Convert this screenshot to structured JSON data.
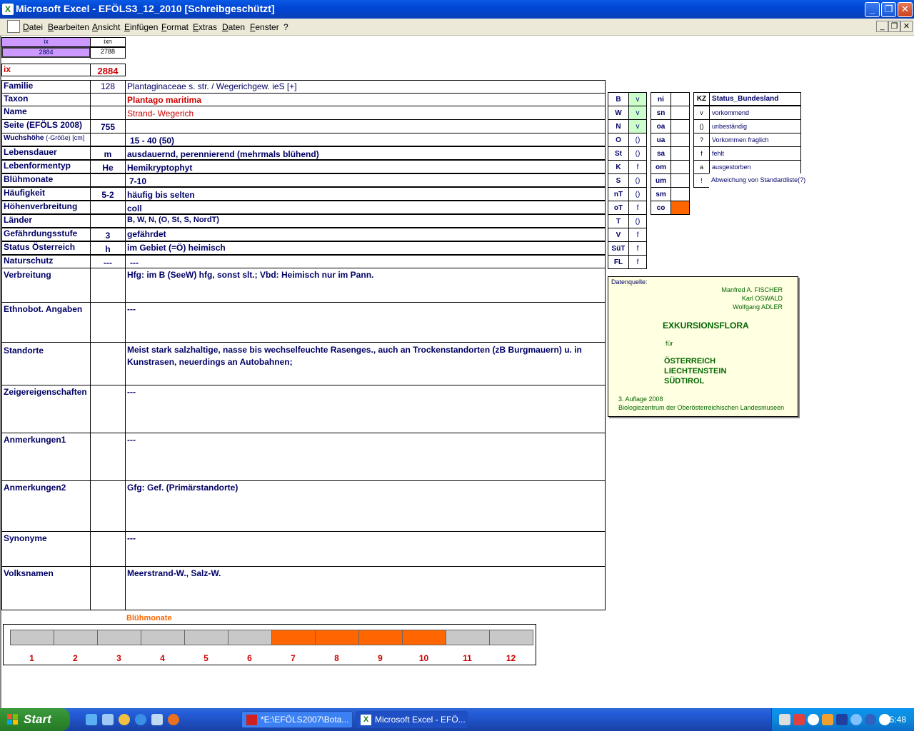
{
  "window": {
    "title": "Microsoft Excel - EFÖLS3_12_2010  [Schreibgeschützt]",
    "app_icon": "X"
  },
  "menu": [
    "Datei",
    "Bearbeiten",
    "Ansicht",
    "Einfügen",
    "Format",
    "Extras",
    "Daten",
    "Fenster",
    "?"
  ],
  "index": {
    "ix_head": "ix",
    "ixn_head": "ixn",
    "ix_val": "2884",
    "ixn_val": "2788",
    "ix_label": "ix",
    "ix_big": "2884"
  },
  "rows": [
    {
      "label": "Familie",
      "code": "128",
      "value": "Plantaginaceae s. str.  /  Wegerichgew. ieS [+]"
    },
    {
      "label": "Taxon",
      "code": "",
      "value": "Plantago maritima"
    },
    {
      "label": "Name",
      "code": "",
      "value": "Strand- Wegerich"
    },
    {
      "label": "Seite (EFÖLS 2008)",
      "code": "755",
      "value": ""
    },
    {
      "label": "Wuchshöhe",
      "label_suffix": "(-Größe) [cm]",
      "code": "",
      "value": "15 - 40 (50)"
    },
    {
      "label": "Lebensdauer",
      "code": "m",
      "value": "ausdauernd, perennierend (mehrmals blühend)"
    },
    {
      "label": "Lebenformentyp",
      "code": "He",
      "value": "Hemikryptophyt"
    },
    {
      "label": "Blühmonate",
      "code": "",
      "value": "7-10"
    },
    {
      "label": "Häufigkeit",
      "code": "5-2",
      "value": "häufig bis selten"
    },
    {
      "label": "Höhenverbreitung",
      "code": "",
      "value": "coll"
    },
    {
      "label": "Länder",
      "code": "",
      "value": "B, W, N, (O, St, S, NordT)"
    },
    {
      "label": "Gefährdungsstufe",
      "code": "3",
      "value": "gefährdet"
    },
    {
      "label": "Status Österreich",
      "code": "h",
      "value": "im Gebiet (=Ö) heimisch"
    },
    {
      "label": "Naturschutz",
      "code": "---",
      "value": "---"
    },
    {
      "label": "Verbreitung",
      "code": "",
      "value": "Hfg:  im B (SeeW) hfg, sonst slt.; Vbd: Heimisch nur im Pann."
    },
    {
      "label": "Ethnobot. Angaben",
      "code": "",
      "value": "---"
    },
    {
      "label": "Standorte",
      "code": "",
      "value": "Meist stark salzhaltige, nasse bis wechselfeuchte Rasenges., auch an Trockenstandorten (zB Burgmauern) u. in Kunstrasen, neuerdings an Autobahnen;"
    },
    {
      "label": "Zeigereigenschaften",
      "code": "",
      "value": "---"
    },
    {
      "label": "Anmerkungen1",
      "code": "",
      "value": "---"
    },
    {
      "label": "Anmerkungen2",
      "code": "",
      "value": "Gfg: Gef. (Primärstandorte)"
    },
    {
      "label": "Synonyme",
      "code": "",
      "value": "---"
    },
    {
      "label": "Volksnamen",
      "code": "",
      "value": "Meerstrand-W., Salz-W."
    }
  ],
  "states": [
    {
      "code": "B",
      "status": "v"
    },
    {
      "code": "W",
      "status": "v"
    },
    {
      "code": "N",
      "status": "v"
    },
    {
      "code": "O",
      "status": "()"
    },
    {
      "code": "St",
      "status": "()"
    },
    {
      "code": "K",
      "status": "f"
    },
    {
      "code": "S",
      "status": "()"
    },
    {
      "code": "nT",
      "status": "()"
    },
    {
      "code": "oT",
      "status": "f"
    },
    {
      "code": "T",
      "status": "()"
    },
    {
      "code": "V",
      "status": "f"
    },
    {
      "code": "SüT",
      "status": "f"
    },
    {
      "code": "FL",
      "status": "f"
    }
  ],
  "zones": [
    "ni",
    "sn",
    "oa",
    "ua",
    "sa",
    "om",
    "um",
    "sm",
    "co"
  ],
  "status_legend": {
    "head_kz": "KZ",
    "head_status": "Status_Bundesland",
    "items": [
      {
        "kz": "v",
        "text": "vorkommend"
      },
      {
        "kz": "()",
        "text": "unbeständig"
      },
      {
        "kz": "?",
        "text": "Vorkommen fraglich"
      },
      {
        "kz": "f",
        "text": "fehlt"
      },
      {
        "kz": "a",
        "text": "ausgestorben"
      },
      {
        "kz": "!",
        "text": "Abweichung von Standardliste(?)"
      }
    ]
  },
  "source": {
    "label": "Datenquelle:",
    "authors": [
      "Manfred A. FISCHER",
      "Karl OSWALD",
      "Wolfgang ADLER"
    ],
    "title": "EXKURSIONSFLORA",
    "fuer": "für",
    "regions": [
      "ÖSTERREICH",
      "LIECHTENSTEIN",
      "SÜDTIROL"
    ],
    "edition": "3. Auflage 2008",
    "publisher": "Biologiezentrum der Oberösterreichischen Landesmuseen"
  },
  "bloom": {
    "title": "Blühmonate",
    "months": [
      "1",
      "2",
      "3",
      "4",
      "5",
      "6",
      "7",
      "8",
      "9",
      "10",
      "11",
      "12"
    ],
    "active": [
      7,
      8,
      9,
      10
    ],
    "active_color": "#ff6600",
    "inactive_color": "#c8c8c8"
  },
  "colors": {
    "accent_purple": "#cc99ff",
    "state_green": "#ccffcc",
    "co_orange": "#ff6600"
  },
  "taskbar": {
    "start": "Start",
    "tasks": [
      "*E:\\EFÖLS2007\\Bota...",
      "Microsoft Excel - EFÖ..."
    ],
    "clock": "15:48"
  }
}
